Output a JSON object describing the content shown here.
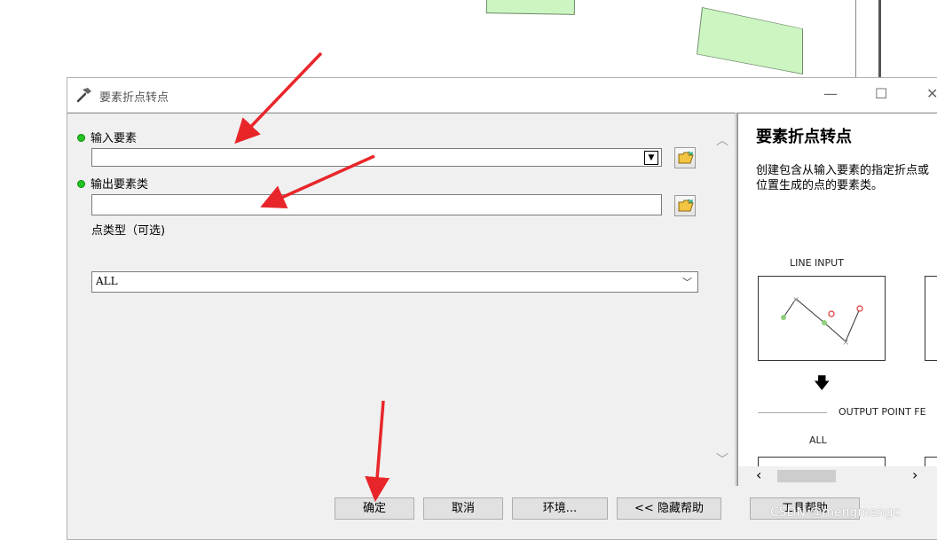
{
  "dialog": {
    "title": "要素折点转点",
    "window_controls": {
      "minimize": "—",
      "maximize": "☐",
      "close": "✕"
    }
  },
  "form": {
    "input_features": {
      "label": "输入要素",
      "value": ""
    },
    "output_feature_class": {
      "label": "输出要素类",
      "value": ""
    },
    "point_type": {
      "label": "点类型（可选)",
      "value": "ALL"
    }
  },
  "help": {
    "title": "要素折点转点",
    "description": "创建包含从输入要素的指定折点或位置生成的点的要素类。",
    "line_input_label": "LINE INPUT",
    "output_label": "OUTPUT POINT FE",
    "all_label": "ALL"
  },
  "buttons": {
    "ok": "确定",
    "cancel": "取消",
    "environments": "环境...",
    "hide_help": "<< 隐藏帮助",
    "tool_help": "工具帮助"
  },
  "watermark": "CSDN @mengmengc",
  "colors": {
    "required_dot": "#22c322",
    "annotation_arrow": "#e8262a",
    "map_polygon": "#ccf5c2"
  }
}
